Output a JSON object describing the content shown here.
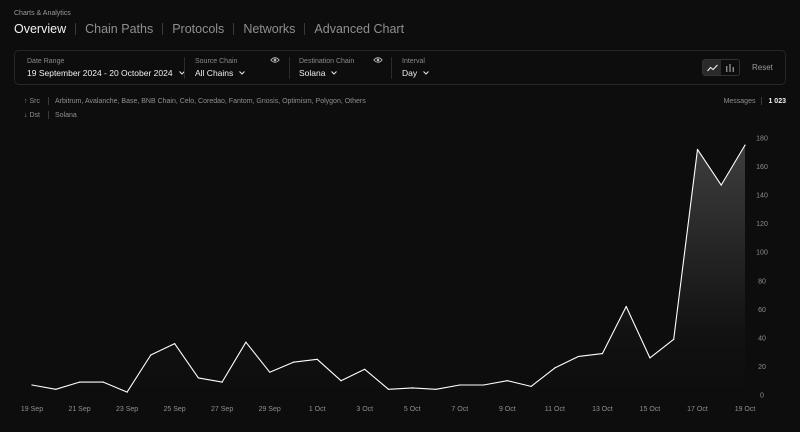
{
  "breadcrumb": "Charts & Analytics",
  "tabs": [
    {
      "label": "Overview"
    },
    {
      "label": "Chain Paths"
    },
    {
      "label": "Protocols"
    },
    {
      "label": "Networks"
    },
    {
      "label": "Advanced Chart"
    }
  ],
  "filters": {
    "date_range": {
      "label": "Date Range",
      "value": "19 September 2024 - 20 October 2024"
    },
    "source_chain": {
      "label": "Source Chain",
      "value": "All Chains"
    },
    "destination_chain": {
      "label": "Destination Chain",
      "value": "Solana"
    },
    "interval": {
      "label": "Interval",
      "value": "Day"
    },
    "reset_label": "Reset"
  },
  "legend": {
    "src_label": "↑ Src",
    "src_value": "Arbitrum, Avalanche, Base, BNB Chain, Celo, Coredao, Fantom, Gnosis, Optimism, Polygon, Others",
    "dst_label": "↓ Dst",
    "dst_value": "Solana"
  },
  "messages": {
    "label": "Messages",
    "count": "1 023"
  },
  "icons": {
    "eye": "eye-icon",
    "line_chart": "line-chart-icon",
    "bar_chart": "bar-chart-icon",
    "chevron": "chevron-down-icon"
  },
  "colors": {
    "background": "#0d0d0d",
    "line": "#ffffff",
    "text_muted": "#8f8f8f"
  },
  "chart_data": {
    "type": "area",
    "x": [
      "19 Sep",
      "20 Sep",
      "21 Sep",
      "22 Sep",
      "23 Sep",
      "24 Sep",
      "25 Sep",
      "26 Sep",
      "27 Sep",
      "28 Sep",
      "29 Sep",
      "30 Sep",
      "1 Oct",
      "2 Oct",
      "3 Oct",
      "4 Oct",
      "5 Oct",
      "6 Oct",
      "7 Oct",
      "8 Oct",
      "9 Oct",
      "10 Oct",
      "11 Oct",
      "12 Oct",
      "13 Oct",
      "14 Oct",
      "15 Oct",
      "16 Oct",
      "17 Oct",
      "18 Oct",
      "19 Oct"
    ],
    "x_ticks": [
      "19 Sep",
      "21 Sep",
      "23 Sep",
      "25 Sep",
      "27 Sep",
      "29 Sep",
      "1 Oct",
      "3 Oct",
      "5 Oct",
      "7 Oct",
      "9 Oct",
      "11 Oct",
      "13 Oct",
      "15 Oct",
      "17 Oct",
      "19 Oct"
    ],
    "series": [
      {
        "values": [
          7,
          4,
          9,
          9,
          2,
          28,
          36,
          12,
          9,
          37,
          16,
          23,
          25,
          10,
          18,
          4,
          5,
          4,
          7,
          7,
          10,
          6,
          19,
          27,
          29,
          62,
          26,
          39,
          172,
          147,
          175
        ]
      }
    ],
    "y_ticks": [
      0,
      20,
      40,
      60,
      80,
      100,
      120,
      140,
      160,
      180
    ],
    "ylim": [
      0,
      180
    ],
    "y_axis_position": "right",
    "grid": false,
    "fill": "gradient under line"
  }
}
